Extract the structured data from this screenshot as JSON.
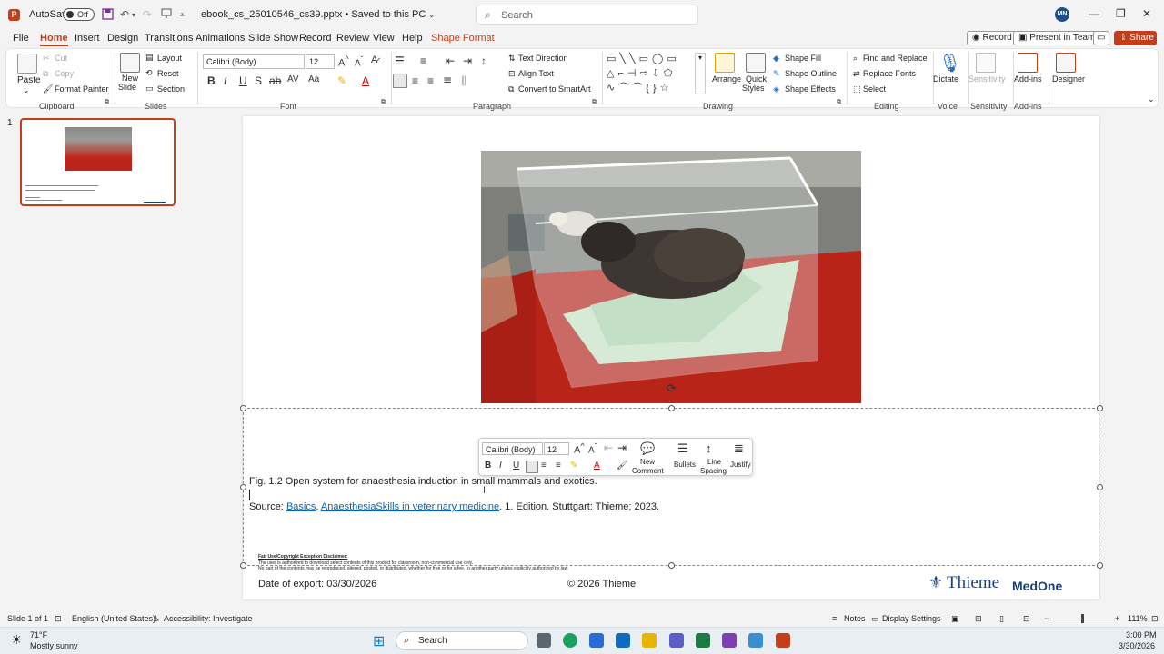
{
  "titlebar": {
    "autosave_label": "AutoSave",
    "autosave_state": "Off",
    "filename": "ebook_cs_25010546_cs39.pptx",
    "save_status": "Saved to this PC",
    "search_placeholder": "Search",
    "user_initials": "MN"
  },
  "tabs": [
    "File",
    "Home",
    "Insert",
    "Design",
    "Transitions",
    "Animations",
    "Slide Show",
    "Record",
    "Review",
    "View",
    "Help",
    "Shape Format"
  ],
  "tab_right": {
    "record": "Record",
    "present": "Present in Teams",
    "share": "Share"
  },
  "ribbon": {
    "clipboard": {
      "paste": "Paste",
      "cut": "Cut",
      "copy": "Copy",
      "format_painter": "Format Painter",
      "group": "Clipboard"
    },
    "slides": {
      "new_slide": "New",
      "new_slide2": "Slide",
      "layout": "Layout",
      "reset": "Reset",
      "section": "Section",
      "group": "Slides"
    },
    "font": {
      "name": "Calibri (Body)",
      "size": "12",
      "group": "Font"
    },
    "paragraph": {
      "text_direction": "Text Direction",
      "align_text": "Align Text",
      "smartart": "Convert to SmartArt",
      "group": "Paragraph"
    },
    "drawing": {
      "arrange": "Arrange",
      "quick_styles": "Quick",
      "quick_styles2": "Styles",
      "shape_fill": "Shape Fill",
      "shape_outline": "Shape Outline",
      "shape_effects": "Shape Effects",
      "group": "Drawing"
    },
    "editing": {
      "find_replace": "Find and Replace",
      "replace_fonts": "Replace Fonts",
      "select": "Select",
      "group": "Editing"
    },
    "voice": {
      "dictate": "Dictate",
      "group": "Voice"
    },
    "sensitivity": {
      "label": "Sensitivity",
      "group": "Sensitivity"
    },
    "addins": {
      "label": "Add-ins",
      "group": "Add-ins"
    },
    "designer": {
      "label": "Designer"
    }
  },
  "thumbnail": {
    "number": "1"
  },
  "slide": {
    "caption": "Fig. 1.2 Open system for anaesthesia induction in small mammals and exotics.",
    "source_prefix": "Source: ",
    "source_link1": "Basics",
    "source_sep": ". ",
    "source_link2": "AnaesthesiaSkills in veterinary medicine",
    "source_suffix": ".  1. Edition. Stuttgart: Thieme; 2023.",
    "disclaimer_title": "Fair Use/Copyright Exception Disclaimer:",
    "disclaimer_line1": "The user is authorized to download select contents of this product for classroom, non-commercial use only.",
    "disclaimer_line2": "No part of the contents may be reproduced, altered, posted, or distributed, whether for free or for a fee, to another party unless explicitly authorized by law.",
    "date_export": "Date of export: 03/30/2026",
    "copyright": "© 2026 Thieme",
    "logo_thieme": "Thieme",
    "logo_medone": "MedOne"
  },
  "minibar": {
    "font": "Calibri (Body)",
    "size": "12",
    "new_comment1": "New",
    "new_comment2": "Comment",
    "bullets": "Bullets",
    "line_spacing1": "Line",
    "line_spacing2": "Spacing",
    "justify": "Justify"
  },
  "statusbar": {
    "slide_of": "Slide 1 of 1",
    "language": "English (United States)",
    "accessibility": "Accessibility: Investigate",
    "notes": "Notes",
    "display_settings": "Display Settings",
    "zoom": "111%"
  },
  "taskbar": {
    "temp": "71°F",
    "weather": "Mostly sunny",
    "search": "Search",
    "time": "3:00 PM",
    "date": "3/30/2026"
  },
  "colors": {
    "accent": "#c43e1c",
    "link": "#0563c1",
    "brand_thieme": "#1c3f73"
  }
}
